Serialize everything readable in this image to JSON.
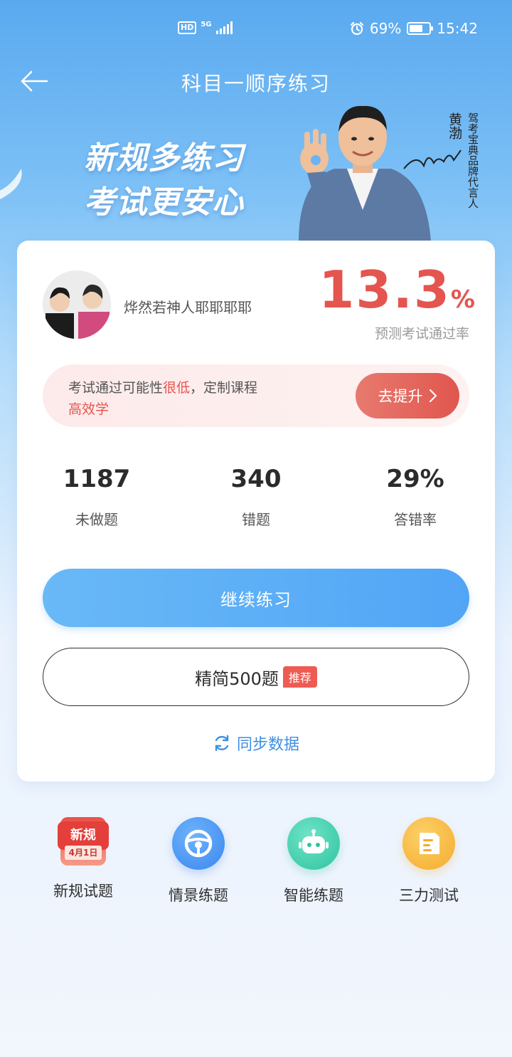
{
  "status_bar": {
    "network_type": "5G",
    "hd_label": "HD",
    "battery": "69%",
    "time": "15:42"
  },
  "header": {
    "title": "科目一顺序练习"
  },
  "banner": {
    "slogan_line1": "新规多练习",
    "slogan_line2": "考试更安心",
    "endorser_name": "黄渤",
    "endorser_role": "驾考宝典品牌代言人"
  },
  "profile": {
    "username": "烨然若神人耶耶耶耶"
  },
  "prediction": {
    "pass_rate_value": "13.3",
    "pass_rate_unit": "%",
    "pass_rate_label": "预测考试通过率"
  },
  "tip": {
    "text_before": "考试通过可能性",
    "text_highlight": "很低",
    "text_after": "，定制课程",
    "text_line2": "高效学",
    "button_label": "去提升"
  },
  "stats": [
    {
      "value": "1187",
      "label": "未做题"
    },
    {
      "value": "340",
      "label": "错题"
    },
    {
      "value": "29%",
      "label": "答错率"
    }
  ],
  "actions": {
    "continue_label": "继续练习",
    "simple_label": "精简500题",
    "simple_badge": "推荐",
    "sync_label": "同步数据"
  },
  "features": [
    {
      "label": "新规试题",
      "icon": "new-rules-calendar-icon",
      "icon_text_top": "新规",
      "icon_text_bottom": "4月1日"
    },
    {
      "label": "情景练题",
      "icon": "steering-wheel-icon"
    },
    {
      "label": "智能练题",
      "icon": "robot-icon"
    },
    {
      "label": "三力测试",
      "icon": "document-icon"
    }
  ],
  "colors": {
    "accent_blue": "#51a5f5",
    "accent_red": "#e4554f",
    "green": "#3fcfae",
    "orange": "#f6b93d"
  }
}
